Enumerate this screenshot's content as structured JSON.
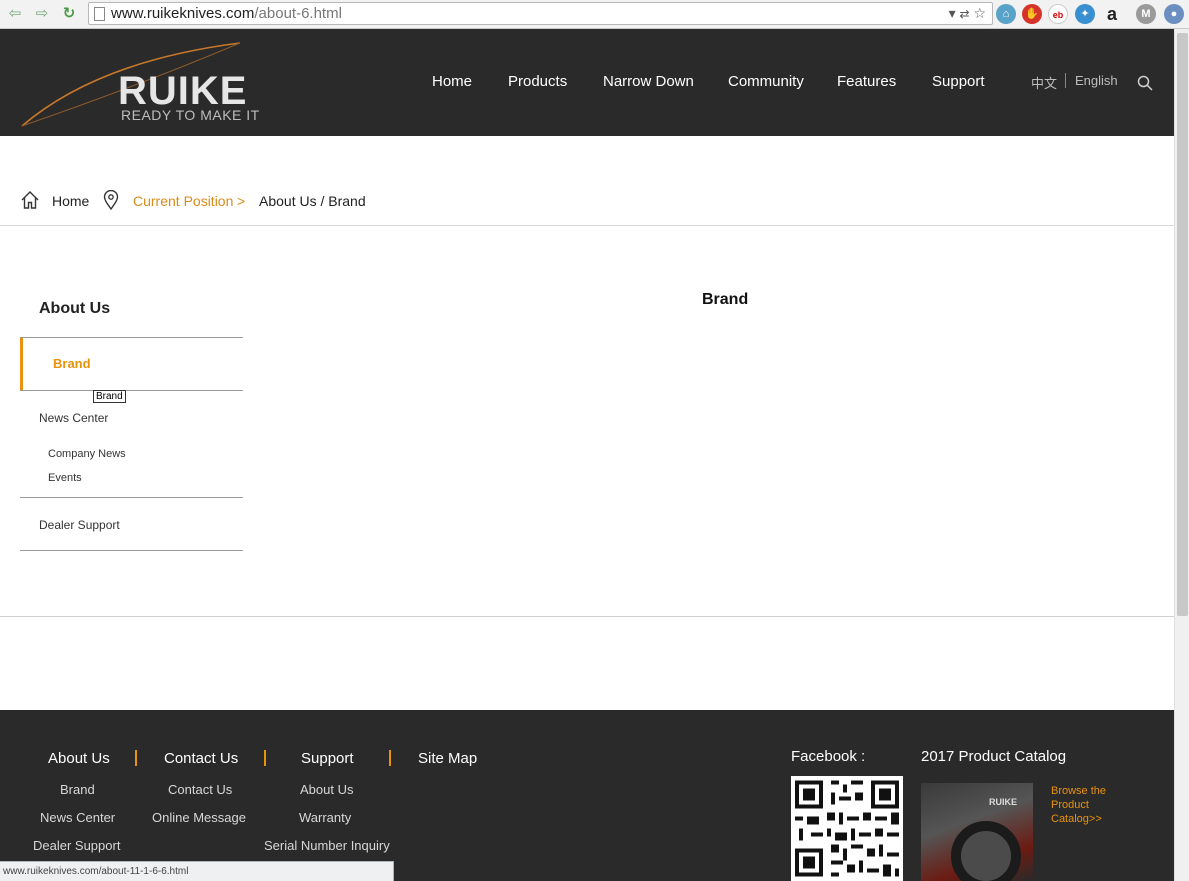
{
  "browser": {
    "url_domain": "www.ruikeknives.com",
    "url_path": "/about-6.html",
    "extensions": [
      "translate-icon",
      "star-icon",
      "home-icon",
      "stop-icon",
      "ebay-icon",
      "bulb-icon",
      "amazon-icon",
      "m-icon",
      "globe-icon"
    ]
  },
  "header": {
    "logo_text": "RUIKE",
    "logo_tagline": "READY TO MAKE IT",
    "nav": [
      "Home",
      "Products",
      "Narrow Down",
      "Community",
      "Features",
      "Support"
    ],
    "lang_cn": "中文",
    "lang_en": "English"
  },
  "breadcrumb": {
    "home": "Home",
    "current_label": "Current Position",
    "arrow": ">",
    "path": "About Us / Brand"
  },
  "sidebar": {
    "title": "About Us",
    "active": "Brand",
    "tooltip": "Brand",
    "news_center": "News Center",
    "news_sub": [
      "Company News",
      "Events"
    ],
    "dealer_support": "Dealer Support"
  },
  "content": {
    "title": "Brand"
  },
  "footer": {
    "columns": [
      {
        "head": "About Us",
        "links": [
          "Brand",
          "News Center",
          "Dealer Support"
        ]
      },
      {
        "head": "Contact Us",
        "links": [
          "Contact Us",
          "Online Message"
        ]
      },
      {
        "head": "Support",
        "links": [
          "About Us",
          "Warranty",
          "Serial Number Inquiry"
        ]
      },
      {
        "head": "Site Map",
        "links": []
      }
    ],
    "facebook_label": "Facebook :",
    "catalog_label": "2017 Product Catalog",
    "catalog_brand": "RUIKE",
    "catalog_link": "Browse the Product Catalog>>"
  },
  "status_bar": {
    "text": "www.ruikeknives.com/about-11-1-6-6.html"
  },
  "colors": {
    "accent": "#e8920e",
    "header_bg": "#2a2a2a"
  }
}
